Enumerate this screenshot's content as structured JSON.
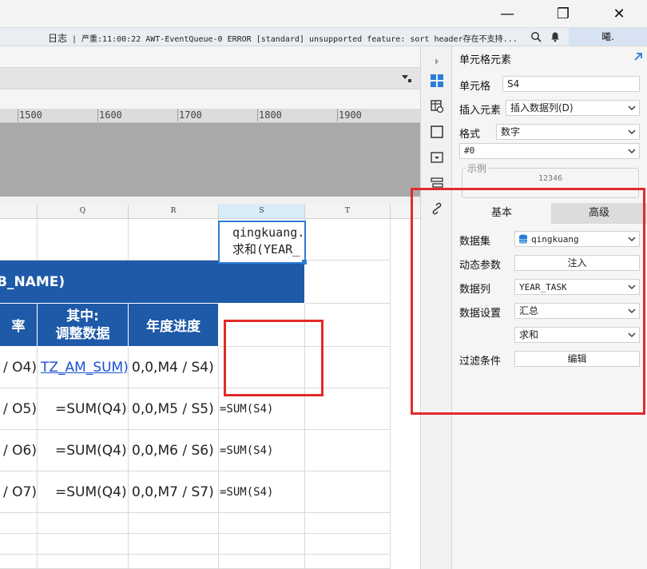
{
  "window": {
    "controls": {
      "minimize": "—",
      "maximize": "❐",
      "close": "✕"
    }
  },
  "logbar": {
    "label": "日志",
    "text": "| 严重:11:00:22 AWT-EventQueue-0 ERROR [standard] unsupported feature: sort header存在不支持...",
    "user": "曦."
  },
  "ruler": {
    "labels": [
      "1500",
      "1600",
      "1700",
      "1800",
      "1900"
    ]
  },
  "columns": [
    "Q",
    "R",
    "S",
    "T"
  ],
  "sheet": {
    "title_row": "B_NAME)",
    "headers": {
      "p": "率",
      "q": "其中:\n调整数据",
      "r": "年度进度"
    },
    "rows": [
      {
        "p": "/ O4)",
        "q": "TZ_AM_SUM)",
        "r": "0,0,M4 / S4)",
        "s": "qingkuang.\n求和(YEAR_"
      },
      {
        "p": "/ O5)",
        "q": "=SUM(Q4)",
        "r": "0,0,M5 / S5)",
        "s": "=SUM(S4)"
      },
      {
        "p": "/ O6)",
        "q": "=SUM(Q4)",
        "r": "0,0,M6 / S6)",
        "s": "=SUM(S4)"
      },
      {
        "p": "/ O7)",
        "q": "=SUM(Q4)",
        "r": "0,0,M7 / S7)",
        "s": "=SUM(S4)"
      }
    ]
  },
  "panel": {
    "title": "单元格元素",
    "cell_label": "单元格",
    "cell_value": "S4",
    "insert_label": "插入元素",
    "insert_value": "插入数据列(D)",
    "format_label": "格式",
    "format_value": "数字",
    "pattern_value": "#0",
    "example_label": "示例",
    "example_value": "12346",
    "tabs": {
      "basic": "基本",
      "advanced": "高级"
    },
    "dataset_label": "数据集",
    "dataset_value": "qingkuang",
    "dynamic_label": "动态参数",
    "dynamic_button": "注入",
    "column_label": "数据列",
    "column_value": "YEAR_TASK",
    "setting_label": "数据设置",
    "setting_value": "汇总",
    "agg_value": "求和",
    "filter_label": "过滤条件",
    "filter_button": "编辑"
  },
  "colors": {
    "header_blue": "#1e5aa8",
    "highlight_red": "#e32a2a",
    "selection_blue": "#2a7dd8"
  }
}
